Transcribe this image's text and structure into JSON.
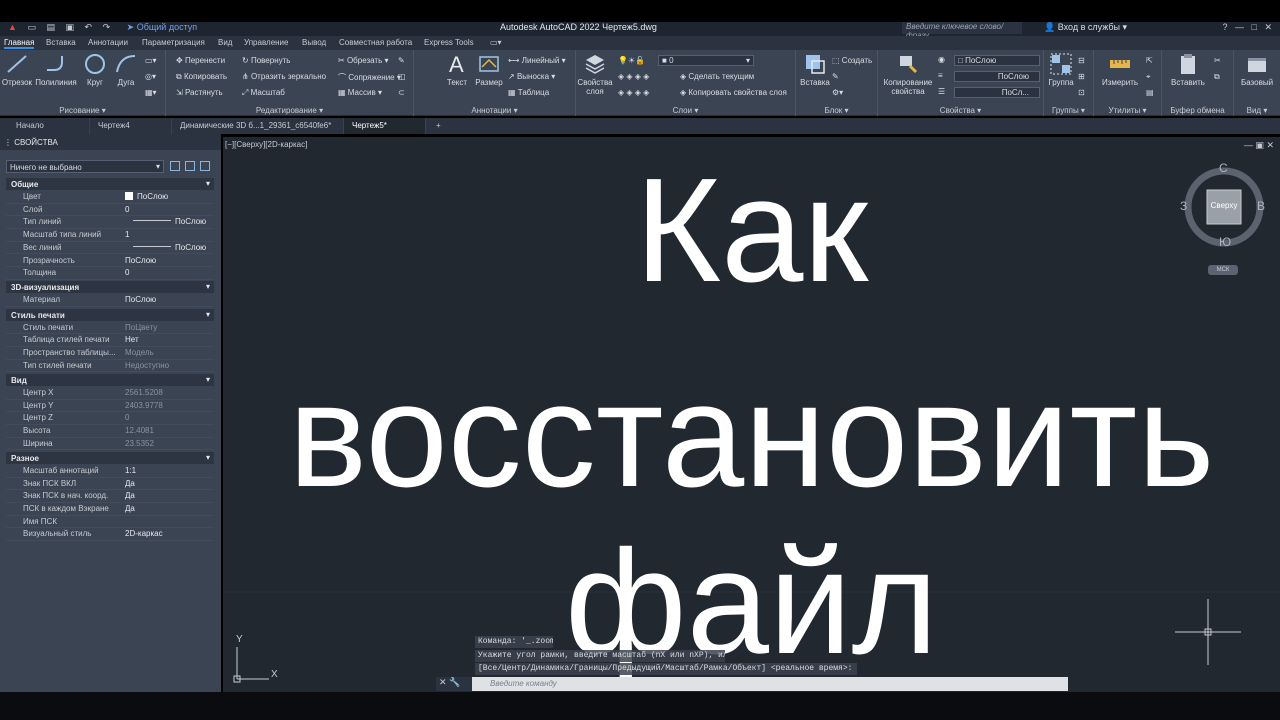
{
  "titlebar": {
    "share": "Общий доступ",
    "app_title": "Autodesk AutoCAD 2022   Чертеж5.dwg",
    "search_placeholder": "Введите ключевое слово/фразу",
    "login": "Вход в службы"
  },
  "menu_tabs": [
    "Главная",
    "Вставка",
    "Аннотации",
    "Параметризация",
    "Вид",
    "Управление",
    "Вывод",
    "Совместная работа",
    "Express Tools"
  ],
  "ribbon": {
    "draw": {
      "label": "Рисование",
      "line": "Отрезок",
      "polyline": "Полилиния",
      "circle": "Круг",
      "arc": "Дуга"
    },
    "modify": {
      "label": "Редактирование",
      "move": "Перенести",
      "rotate": "Повернуть",
      "trim": "Обрезать",
      "copy": "Копировать",
      "mirror": "Отразить зеркально",
      "fillet": "Сопряжение",
      "stretch": "Растянуть",
      "scale": "Масштаб",
      "array": "Массив"
    },
    "annotation": {
      "label": "Аннотации",
      "text": "Текст",
      "dimension": "Размер",
      "linear": "Линейный",
      "leader": "Выноска",
      "table": "Таблица"
    },
    "layers": {
      "label": "Слои",
      "properties": "Свойства слоя",
      "current_layer": "0",
      "make_current": "Сделать текущим",
      "match_layer": "Копировать свойства слоя"
    },
    "block": {
      "label": "Блок",
      "insert": "Вставка",
      "create": "Создать"
    },
    "properties": {
      "label": "Свойства",
      "match": "Копирование свойства",
      "color": "ПоСлою",
      "linetype": "ПоСлою",
      "lineweight": "ПоСл..."
    },
    "groups": {
      "label": "Группы",
      "group": "Группа"
    },
    "utilities": {
      "label": "Утилиты",
      "measure": "Измерить"
    },
    "clipboard": {
      "label": "Буфер обмена",
      "paste": "Вставить"
    },
    "view": {
      "label": "Вид",
      "base": "Базовый"
    }
  },
  "doc_tabs": [
    "Начало",
    "Чертеж4",
    "Динамические 3D б...1_29361_c6540fe6*",
    "Чертеж5*"
  ],
  "properties_palette": {
    "title": "СВОЙСТВА",
    "selection": "Ничего не выбрано",
    "sections": [
      {
        "name": "Общие",
        "rows": [
          {
            "k": "Цвет",
            "v": "ПоСлою",
            "swatch": true
          },
          {
            "k": "Слой",
            "v": "0"
          },
          {
            "k": "Тип линий",
            "v": "ПоСлою",
            "line": true
          },
          {
            "k": "Масштаб типа линий",
            "v": "1"
          },
          {
            "k": "Вес линий",
            "v": "ПоСлою",
            "line": true
          },
          {
            "k": "Прозрачность",
            "v": "ПоСлою"
          },
          {
            "k": "Толщина",
            "v": "0"
          }
        ]
      },
      {
        "name": "3D-визуализация",
        "rows": [
          {
            "k": "Материал",
            "v": "ПоСлою"
          }
        ]
      },
      {
        "name": "Стиль печати",
        "rows": [
          {
            "k": "Стиль печати",
            "v": "ПоЦвету",
            "dim": true
          },
          {
            "k": "Таблица стилей печати",
            "v": "Нет"
          },
          {
            "k": "Пространство таблицы...",
            "v": "Модель",
            "dim": true
          },
          {
            "k": "Тип стилей печати",
            "v": "Недоступно",
            "dim": true
          }
        ]
      },
      {
        "name": "Вид",
        "rows": [
          {
            "k": "Центр X",
            "v": "2561.5208",
            "dim": true
          },
          {
            "k": "Центр Y",
            "v": "2403.9778",
            "dim": true
          },
          {
            "k": "Центр Z",
            "v": "0",
            "dim": true
          },
          {
            "k": "Высота",
            "v": "12.4081",
            "dim": true
          },
          {
            "k": "Ширина",
            "v": "23.5352",
            "dim": true
          }
        ]
      },
      {
        "name": "Разное",
        "rows": [
          {
            "k": "Масштаб аннотаций",
            "v": "1:1"
          },
          {
            "k": "Знак ПСК ВКЛ",
            "v": "Да"
          },
          {
            "k": "Знак ПСК в нач. коорд.",
            "v": "Да"
          },
          {
            "k": "ПСК в каждом Вэкране",
            "v": "Да"
          },
          {
            "k": "Имя ПСК",
            "v": ""
          },
          {
            "k": "Визуальный стиль",
            "v": "2D-каркас"
          }
        ]
      }
    ]
  },
  "viewport": {
    "label": "[−][Сверху][2D-каркас]",
    "overlay_lines": [
      "Как",
      "восстановить",
      "файл"
    ],
    "viewcube": {
      "top": "Сверху",
      "n": "С",
      "s": "Ю",
      "w": "З",
      "e": "В",
      "ucs": "МСК"
    },
    "ucs_x": "X",
    "ucs_y": "Y"
  },
  "command": {
    "history": [
      "Команда: '_.zoom",
      "Укажите угол рамки, введите масштаб (nX или nXP), или",
      "[Все/Центр/Динамика/Границы/Предыдущий/Масштаб/Рамка/Объект] <реальное время>: _e"
    ],
    "placeholder": "Введите команду"
  }
}
